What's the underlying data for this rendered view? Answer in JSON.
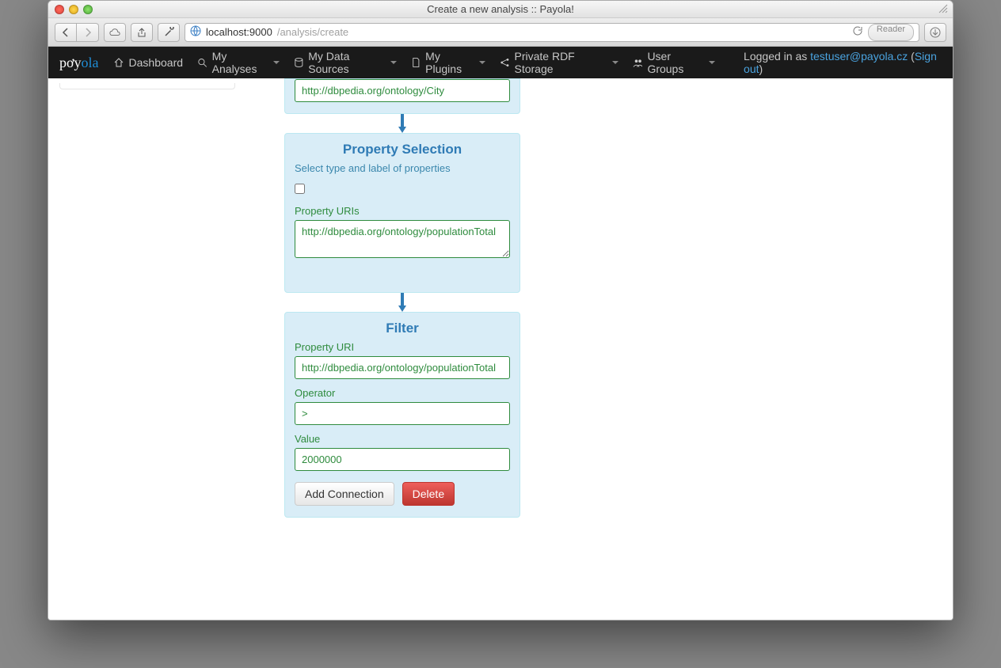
{
  "window": {
    "title": "Create a new analysis :: Payola!"
  },
  "browser": {
    "url_host": "localhost:9000",
    "url_path": "/analysis/create",
    "reader_label": "Reader"
  },
  "nav": {
    "logo": "pơyola",
    "items": [
      {
        "label": "Dashboard",
        "icon": "home-icon",
        "dropdown": false
      },
      {
        "label": "My Analyses",
        "icon": "search-icon",
        "dropdown": true
      },
      {
        "label": "My Data Sources",
        "icon": "database-icon",
        "dropdown": true
      },
      {
        "label": "My Plugins",
        "icon": "file-icon",
        "dropdown": true
      },
      {
        "label": "Private RDF Storage",
        "icon": "share-icon",
        "dropdown": true
      },
      {
        "label": "User Groups",
        "icon": "users-icon",
        "dropdown": true
      }
    ],
    "login": {
      "prefix": "Logged in as ",
      "user": "testuser@payola.cz",
      "signout": "Sign out"
    }
  },
  "nodes": {
    "typed": {
      "input_value": "http://dbpedia.org/ontology/City"
    },
    "propsel": {
      "title": "Property Selection",
      "subtitle": "Select type and label of properties",
      "checked": false,
      "uris_label": "Property URIs",
      "uris_value": "http://dbpedia.org/ontology/populationTotal"
    },
    "filter": {
      "title": "Filter",
      "prop_label": "Property URI",
      "prop_value": "http://dbpedia.org/ontology/populationTotal",
      "op_label": "Operator",
      "op_value": ">",
      "val_label": "Value",
      "val_value": "2000000",
      "add_btn": "Add Connection",
      "del_btn": "Delete"
    }
  }
}
